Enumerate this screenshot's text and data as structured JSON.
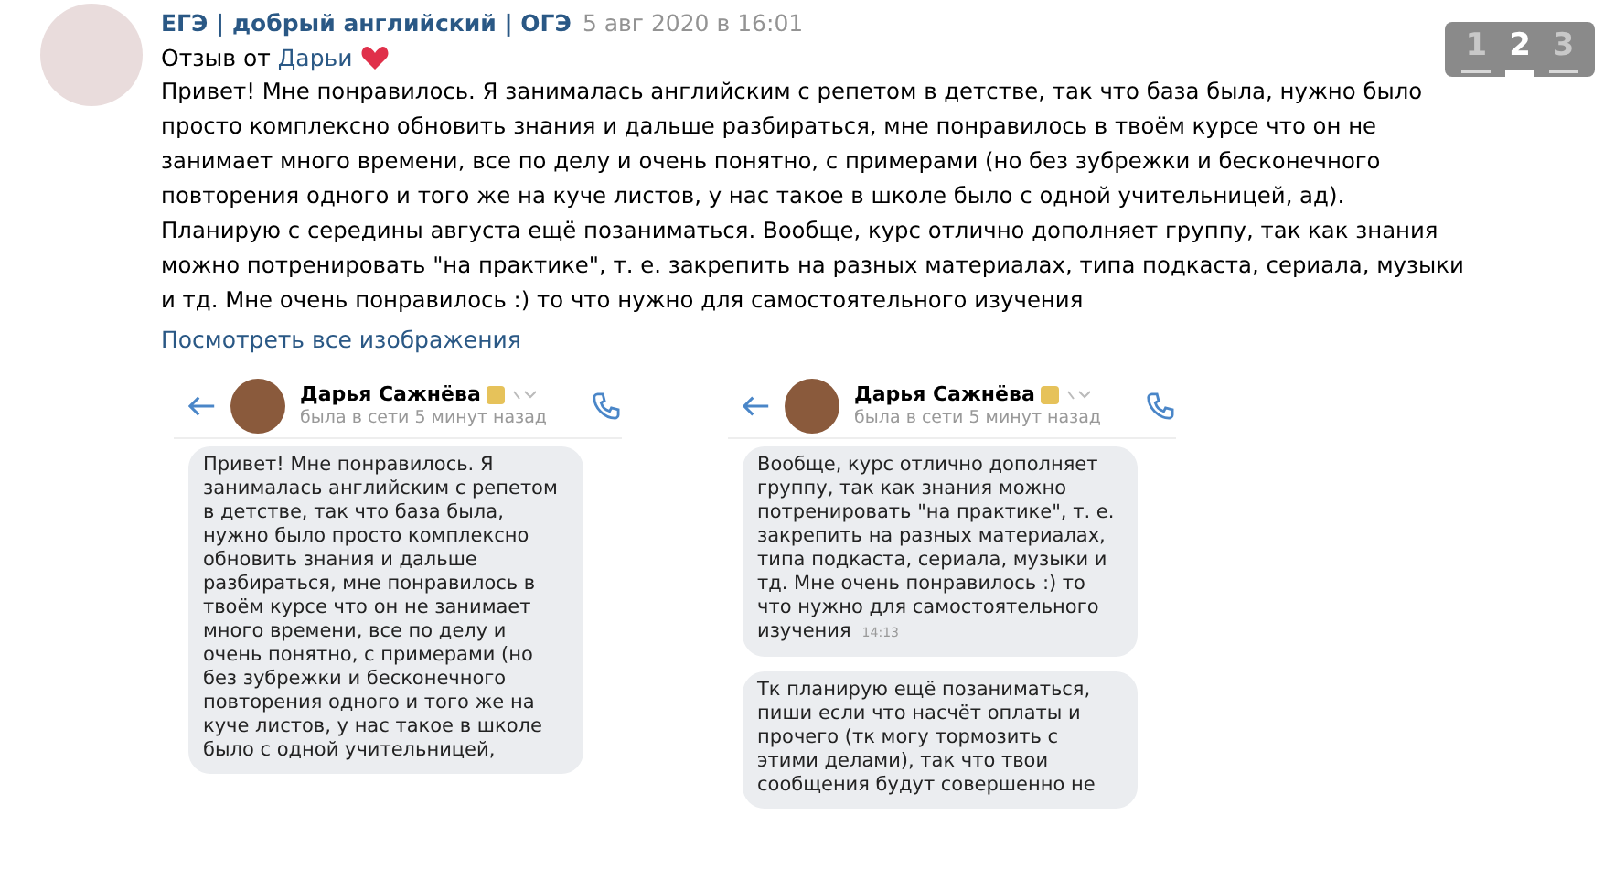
{
  "post": {
    "author": "ЕГЭ | добрый английский | ОГЭ",
    "date": "5 авг 2020 в 16:01",
    "intro": "Отзыв от",
    "intro_link": "Дарьи",
    "text": "Привет! Мне понравилось. Я занималась английским с репетом в детстве, так что база была, нужно было просто комплексно обновить знания и дальше разбираться, мне понравилось в твоём курсе что он не занимает много времени, все по делу и очень понятно, с примерами (но без зубрежки и бесконечного повторения одного и того же на куче листов, у нас такое в школе было с одной учительницей, ад). Планирую с середины августа ещё позаниматься. Вообще, курс отлично дополняет группу, так как знания можно потренировать \"на практике\", т. е. закрепить на разных материалах, типа подкаста, сериала, музыки и тд. Мне очень понравилось :) то что нужно для самостоятельного изучения",
    "show_all_link": "Посмотреть все изображения"
  },
  "pager": [
    {
      "label": "1",
      "selected": false
    },
    {
      "label": "2",
      "selected": true
    },
    {
      "label": "3",
      "selected": false
    }
  ],
  "screenshots": [
    {
      "contact_name": "Дарья Сажнёва",
      "status": "была в сети 5 минут назад",
      "messages": [
        {
          "text": "Привет! Мне понравилось. Я занималась английским с репетом в детстве, так что база была, нужно было просто комплексно обновить знания и дальше разбираться, мне понравилось в твоём курсе что он не занимает много времени, все по делу и очень понятно, с примерами (но без зубрежки и бесконечного повторения одного и того же на куче листов, у нас такое в школе было с одной учительницей,"
        }
      ]
    },
    {
      "contact_name": "Дарья Сажнёва",
      "status": "была в сети 5 минут назад",
      "messages": [
        {
          "text": "Вообще, курс отлично дополняет группу, так как знания можно потренировать \"на практике\", т. е. закрепить на разных материалах, типа подкаста, сериала, музыки и тд. Мне очень понравилось :) то что нужно для самостоятельного изучения",
          "time": "14:13"
        },
        {
          "text": "Тк планирую ещё позаниматься, пиши если что насчёт оплаты и прочего (тк могу тормозить с этими делами), так что твои сообщения будут совершенно не"
        }
      ]
    }
  ]
}
